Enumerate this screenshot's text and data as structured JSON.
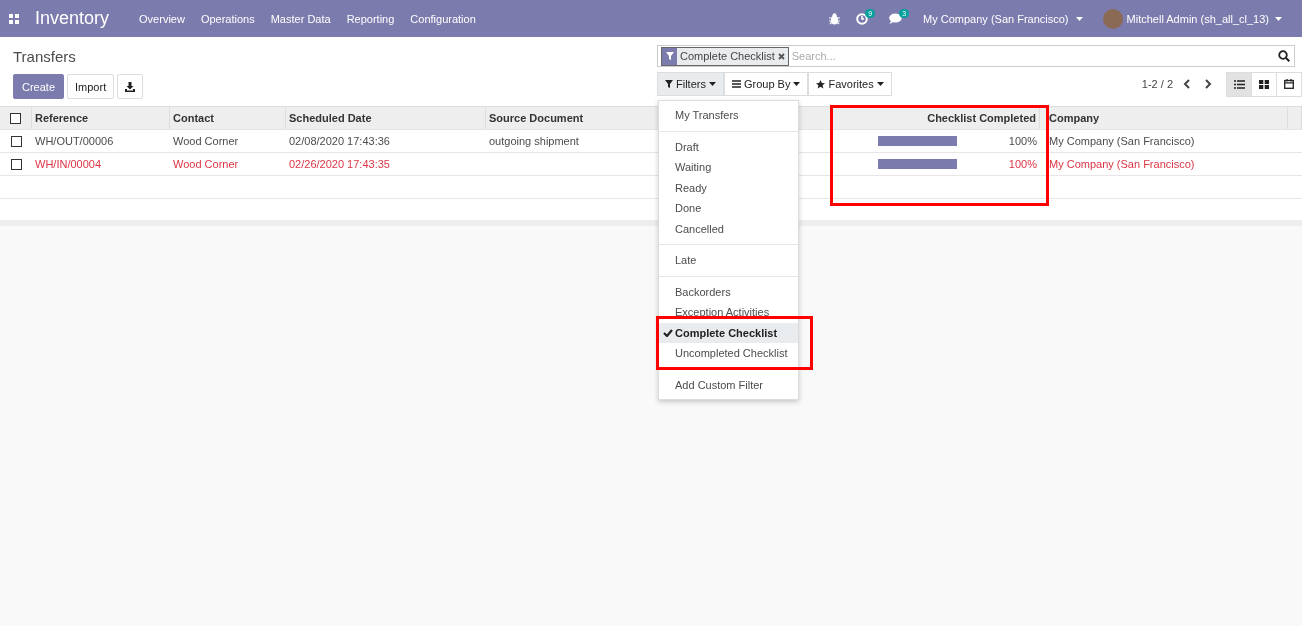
{
  "navbar": {
    "app_title": "Inventory",
    "menu": [
      "Overview",
      "Operations",
      "Master Data",
      "Reporting",
      "Configuration"
    ],
    "activity_count": "9",
    "message_count": "3",
    "company": "My Company (San Francisco)",
    "user": "Mitchell Admin (sh_all_cl_13)"
  },
  "control_panel": {
    "breadcrumb": "Transfers",
    "buttons": [
      "Create",
      "Import"
    ],
    "search": {
      "facet": "Complete Checklist",
      "placeholder": "Search..."
    },
    "search_buttons": [
      {
        "label": "Filters",
        "kind": "filter",
        "selected": true
      },
      {
        "label": "Group By",
        "kind": "group",
        "selected": false
      },
      {
        "label": "Favorites",
        "kind": "star",
        "selected": false
      }
    ],
    "pager": "1-2 / 2",
    "views": [
      {
        "kind": "list",
        "selected": true
      },
      {
        "kind": "kanban",
        "selected": false
      },
      {
        "kind": "calendar",
        "selected": false
      }
    ]
  },
  "filters_menu": [
    [
      {
        "label": "My Transfers",
        "checked": false
      }
    ],
    [
      {
        "label": "Draft",
        "checked": false
      },
      {
        "label": "Waiting",
        "checked": false
      },
      {
        "label": "Ready",
        "checked": false
      },
      {
        "label": "Done",
        "checked": false
      },
      {
        "label": "Cancelled",
        "checked": false
      }
    ],
    [
      {
        "label": "Late",
        "checked": false
      }
    ],
    [
      {
        "label": "Backorders",
        "checked": false
      },
      {
        "label": "Exception Activities",
        "checked": false
      },
      {
        "label": "Complete Checklist",
        "checked": true
      },
      {
        "label": "Uncompleted Checklist",
        "checked": false
      }
    ],
    [
      {
        "label": "Add Custom Filter",
        "checked": false
      }
    ]
  ],
  "table": {
    "select_all_checked": false,
    "columns": [
      "Reference",
      "Contact",
      "Scheduled Date",
      "Source Document",
      "Checklist Completed",
      "Company"
    ],
    "rows": [
      {
        "reference": "WH/OUT/00006",
        "contact": "Wood Corner",
        "scheduled_date": "02/08/2020 17:43:36",
        "source_document": "outgoing shipment",
        "level": 1,
        "checklist": "100%",
        "company": "My Company (San Francisco)",
        "late": false,
        "checked": false
      },
      {
        "reference": "WH/IN/00004",
        "contact": "Wood Corner",
        "scheduled_date": "02/26/2020 17:43:35",
        "level": 1,
        "checklist": "100%",
        "company": "My Company (San Francisco)",
        "late": true,
        "checked": false
      }
    ]
  }
}
